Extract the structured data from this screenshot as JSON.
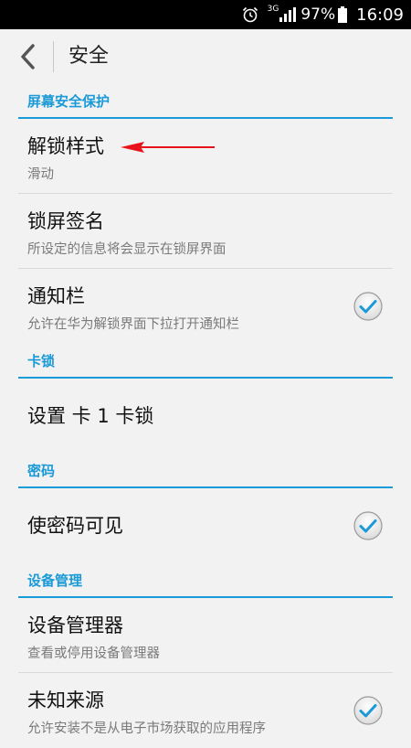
{
  "status_bar": {
    "network": "3G",
    "battery_percent": "97%",
    "time": "16:09",
    "icons": [
      "alarm-icon",
      "signal-icon",
      "battery-icon"
    ]
  },
  "header": {
    "title": "安全",
    "back_icon": "chevron-left-icon"
  },
  "colors": {
    "accent": "#1a9ad6",
    "annotation_arrow": "#e8131a",
    "background": "#f2f2f2",
    "status_bar": "#000000"
  },
  "sections": {
    "screen_security": {
      "title": "屏幕安全保护",
      "unlock_style": {
        "title": "解锁样式",
        "summary": "滑动"
      },
      "lock_signature": {
        "title": "锁屏签名",
        "summary": "所设定的信息将会显示在锁屏界面"
      },
      "notification_bar": {
        "title": "通知栏",
        "summary": "允许在华为解锁界面下拉打开通知栏",
        "checked": true
      }
    },
    "sim_lock": {
      "title": "卡锁",
      "setup": {
        "title": "设置 卡 1 卡锁"
      }
    },
    "password": {
      "title": "密码",
      "visible": {
        "title": "使密码可见",
        "checked": true
      }
    },
    "device_admin": {
      "title": "设备管理",
      "admins": {
        "title": "设备管理器",
        "summary": "查看或停用设备管理器"
      },
      "unknown_sources": {
        "title": "未知来源",
        "summary": "允许安装不是从电子市场获取的应用程序",
        "checked": true
      }
    }
  }
}
